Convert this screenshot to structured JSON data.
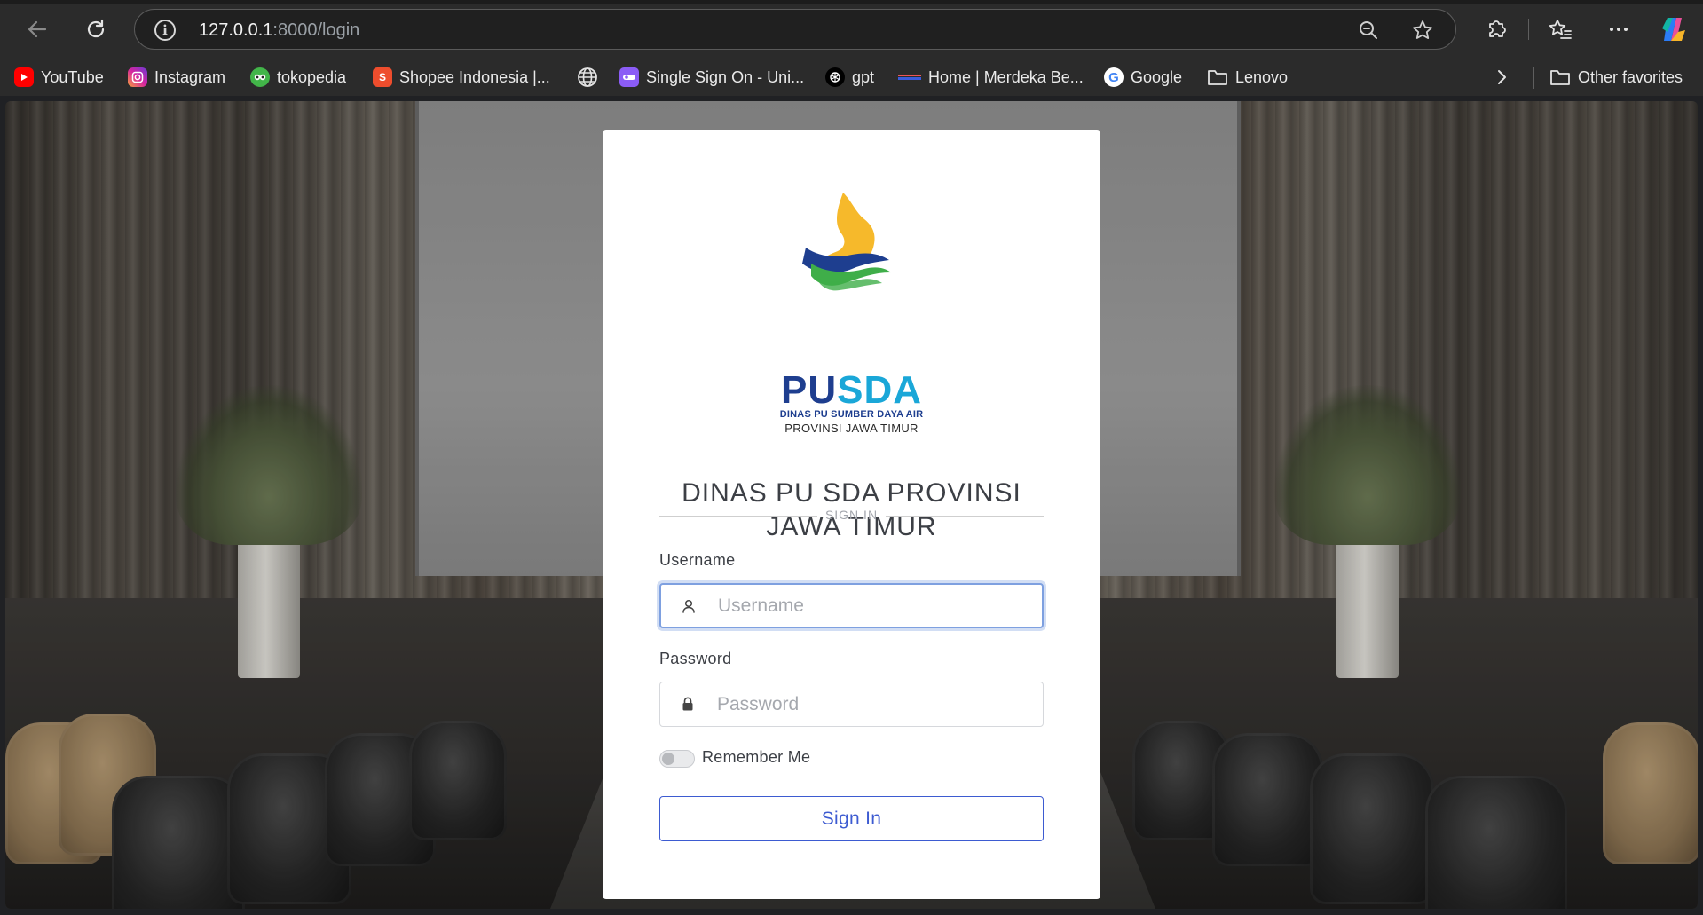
{
  "browser": {
    "url_host": "127.0.0.1",
    "url_rest": ":8000/login",
    "bookmarks": [
      {
        "label": "YouTube",
        "icon": "youtube-icon",
        "color": "#ff0000"
      },
      {
        "label": "Instagram",
        "icon": "instagram-icon",
        "color": "#d6249f"
      },
      {
        "label": "tokopedia",
        "icon": "tokopedia-icon",
        "color": "#42b549"
      },
      {
        "label": "Shopee Indonesia |...",
        "icon": "shopee-icon",
        "color": "#ee4d2d"
      },
      {
        "label": "",
        "icon": "globe-icon",
        "color": "#dddddd"
      },
      {
        "label": "Single Sign On - Uni...",
        "icon": "sso-icon",
        "color": "#8b5cf6"
      },
      {
        "label": "gpt",
        "icon": "openai-icon",
        "color": "#000000"
      },
      {
        "label": "Home | Merdeka Be...",
        "icon": "merdeka-icon",
        "color": "#3b5bdb"
      },
      {
        "label": "Google",
        "icon": "google-icon",
        "color": "#4285f4"
      },
      {
        "label": "Lenovo",
        "icon": "folder-icon",
        "color": "#dddddd"
      }
    ],
    "other_favorites": "Other favorites"
  },
  "login": {
    "brand_pu": "PU",
    "brand_sda": "SDA",
    "brand_sub1": "DINAS PU SUMBER DAYA AIR",
    "brand_sub2": "PROVINSI JAWA TIMUR",
    "title_line1": "DINAS PU SDA PROVINSI",
    "title_line2": "JAWA TIMUR",
    "divider_label": "SIGN IN",
    "username_label": "Username",
    "username_placeholder": "Username",
    "username_value": "",
    "password_label": "Password",
    "password_placeholder": "Password",
    "password_value": "",
    "remember_label": "Remember Me",
    "remember_checked": false,
    "signin_label": "Sign In",
    "colors": {
      "brand_blue": "#1e3e8f",
      "brand_cyan": "#1aa7d8",
      "brand_yellow": "#f6b92b",
      "brand_green": "#3fae49",
      "button_blue": "#3d5bd1"
    }
  }
}
